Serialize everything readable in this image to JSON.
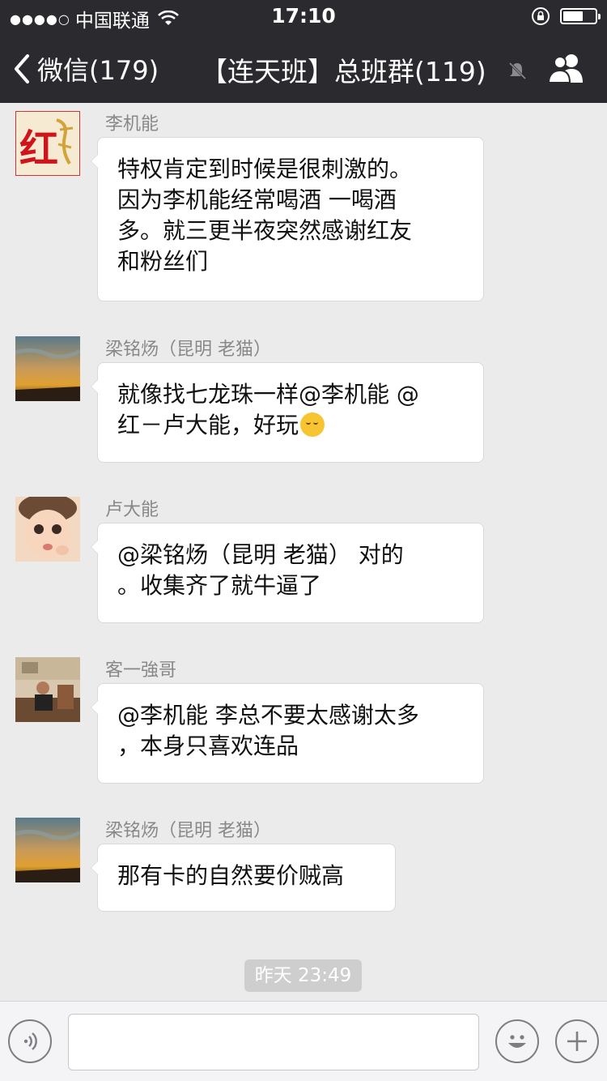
{
  "status_bar": {
    "signal": "●●●●○",
    "carrier": "中国联通",
    "time": "17:10",
    "icons": [
      "wifi-icon",
      "orientation-lock-icon",
      "battery-icon"
    ]
  },
  "nav": {
    "back_label": "微信(179)",
    "title": "【连天班】总班群(119)",
    "icons": [
      "back-chevron-icon",
      "mute-icon",
      "group-members-icon"
    ]
  },
  "messages": [
    {
      "sender": "李机能",
      "avatar_text": "红",
      "lines": [
        "特权肯定到时候是很刺激的。",
        "因为李机能经常喝酒  一喝酒",
        "多。就三更半夜突然感谢红友",
        "和粉丝们"
      ]
    },
    {
      "sender": "梁铭炀（昆明 老猫）",
      "lines": [
        "就像找七龙珠一样@李机能 @",
        "红－卢大能，好玩"
      ],
      "emoji": "smiling-face-emoji"
    },
    {
      "sender": "卢大能",
      "lines": [
        "@梁铭炀（昆明 老猫） 对的",
        "。收集齐了就牛逼了"
      ]
    },
    {
      "sender": "客一強哥",
      "lines": [
        "@李机能 李总不要太感谢太多",
        "，本身只喜欢连品"
      ]
    },
    {
      "sender": "梁铭炀（昆明 老猫）",
      "lines": [
        "那有卡的自然要价贼高"
      ]
    }
  ],
  "timestamp": "昨天 23:49",
  "input_bar": {
    "icons": [
      "voice-icon",
      "emoji-icon",
      "plus-icon"
    ],
    "placeholder": ""
  },
  "colors": {
    "header": "#2b2b2f",
    "chat_background": "#ebebeb",
    "bubble": "#ffffff",
    "timestamp_bg": "#cecece"
  }
}
